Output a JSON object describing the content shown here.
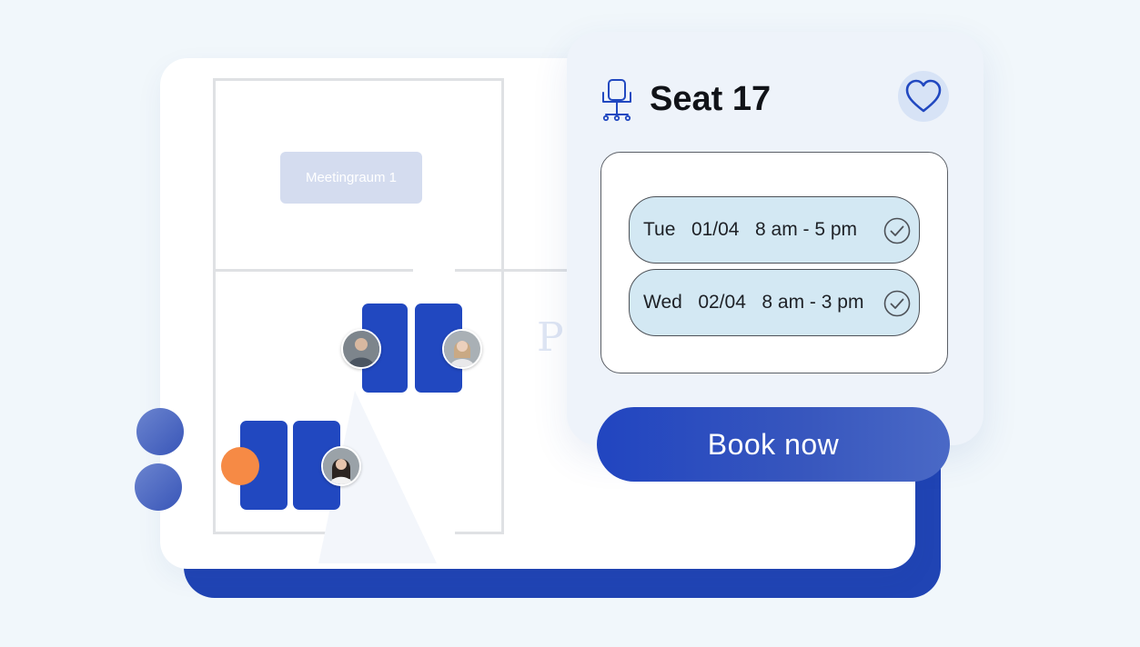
{
  "floor_plan": {
    "room_label": "Meetingraum 1",
    "ghost_letter": "P"
  },
  "seat_panel": {
    "icon": "office-chair-icon",
    "title": "Seat 17",
    "favorite_icon": "heart-icon",
    "slots": [
      {
        "day": "Tue",
        "date": "01/04",
        "time": "8 am - 5 pm",
        "status_icon": "check-circle-icon"
      },
      {
        "day": "Wed",
        "date": "02/04",
        "time": "8 am - 3 pm",
        "status_icon": "check-circle-icon"
      }
    ],
    "book_label": "Book now"
  },
  "colors": {
    "accent": "#2148c0",
    "slot_bg": "#d3e8f3",
    "available_marker": "#f68a45"
  }
}
